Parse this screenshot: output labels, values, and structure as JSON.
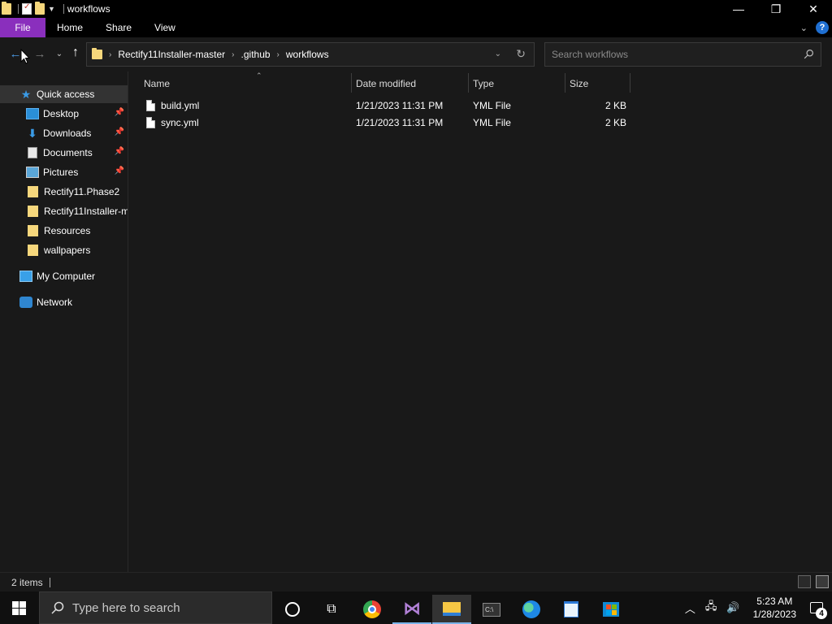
{
  "window": {
    "title": "workflows",
    "minimize": "—",
    "restore": "❐",
    "close": "✕"
  },
  "ribbon": {
    "tabs": [
      {
        "label": "File"
      },
      {
        "label": "Home"
      },
      {
        "label": "Share"
      },
      {
        "label": "View"
      }
    ],
    "help": "?"
  },
  "address": {
    "crumbs": [
      "Rectify11Installer-master",
      ".github",
      "workflows"
    ],
    "search_placeholder": "Search workflows"
  },
  "navpane": {
    "items": [
      {
        "label": "Quick access",
        "icon": "star-icon"
      },
      {
        "label": "Desktop",
        "icon": "desktop-icon",
        "pinned": true
      },
      {
        "label": "Downloads",
        "icon": "download-icon",
        "pinned": true
      },
      {
        "label": "Documents",
        "icon": "documents-icon",
        "pinned": true
      },
      {
        "label": "Pictures",
        "icon": "pictures-icon",
        "pinned": true
      },
      {
        "label": "Rectify11.Phase2",
        "icon": "folder-icon"
      },
      {
        "label": "Rectify11Installer-m",
        "icon": "folder-icon"
      },
      {
        "label": "Resources",
        "icon": "folder-icon"
      },
      {
        "label": "wallpapers",
        "icon": "folder-icon"
      },
      {
        "label": "My Computer",
        "icon": "computer-icon"
      },
      {
        "label": "Network",
        "icon": "network-icon"
      }
    ]
  },
  "filelist": {
    "columns": [
      "Name",
      "Date modified",
      "Type",
      "Size"
    ],
    "rows": [
      {
        "name": "build.yml",
        "date": "1/21/2023 11:31 PM",
        "type": "YML File",
        "size": "2 KB"
      },
      {
        "name": "sync.yml",
        "date": "1/21/2023 11:31 PM",
        "type": "YML File",
        "size": "2 KB"
      }
    ]
  },
  "status": {
    "count": "2 items"
  },
  "taskbar": {
    "search_placeholder": "Type here to search",
    "time": "5:23 AM",
    "date": "1/28/2023",
    "notification_count": "4"
  },
  "colors": {
    "accent_file_tab": "#8a2fbd",
    "background": "#191919"
  }
}
